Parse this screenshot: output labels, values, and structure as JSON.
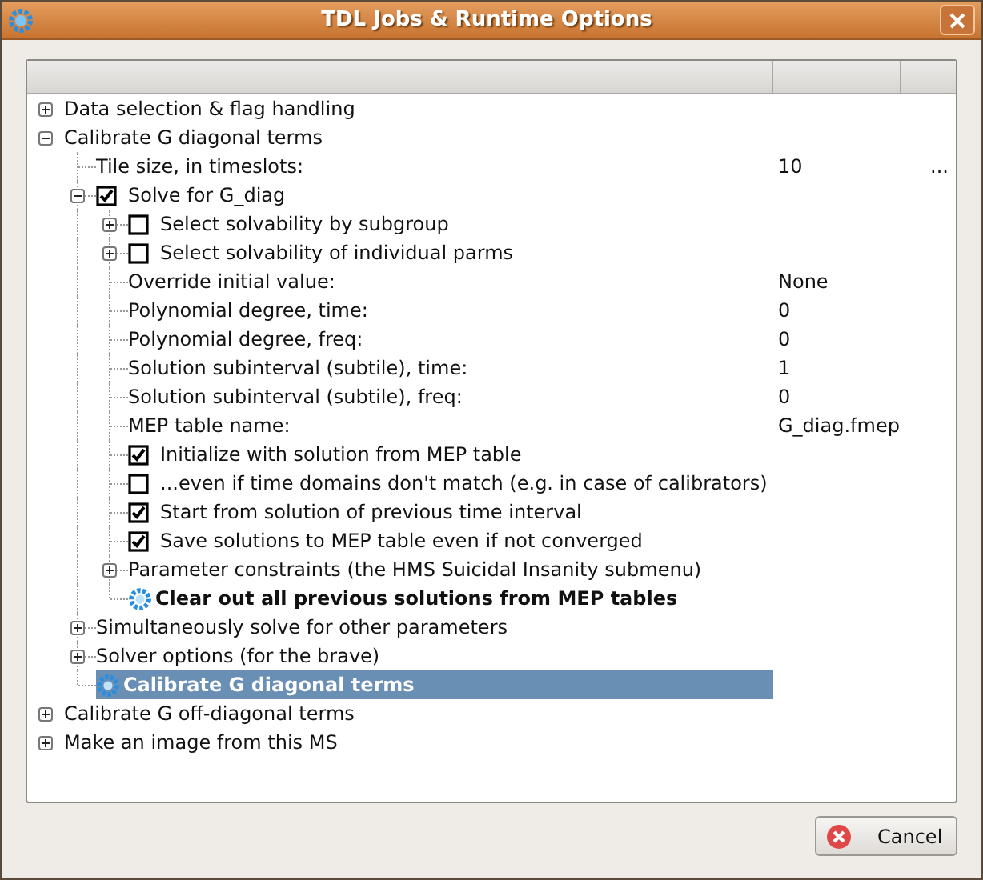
{
  "window": {
    "title": "TDL Jobs & Runtime Options"
  },
  "tree": [
    {
      "kind": "group",
      "label": "Data selection & flag handling",
      "expanded": false,
      "selected": false
    },
    {
      "kind": "group",
      "label": "Calibrate G diagonal terms",
      "expanded": true,
      "selected": false,
      "children": [
        {
          "kind": "option",
          "label": "Tile size, in timeslots:",
          "value": "10",
          "extra": "...",
          "selected": false
        },
        {
          "kind": "checkbox",
          "label": "Solve for G_diag",
          "checked": true,
          "expanded": true,
          "selected": false,
          "children": [
            {
              "kind": "checkbox",
              "label": "Select solvability by subgroup",
              "checked": false,
              "expanded": false,
              "selected": false
            },
            {
              "kind": "checkbox",
              "label": "Select solvability of individual parms",
              "checked": false,
              "expanded": false,
              "selected": false
            },
            {
              "kind": "option",
              "label": "Override initial value:",
              "value": "None",
              "selected": false
            },
            {
              "kind": "option",
              "label": "Polynomial degree, time:",
              "value": "0",
              "selected": false
            },
            {
              "kind": "option",
              "label": "Polynomial degree, freq:",
              "value": "0",
              "selected": false
            },
            {
              "kind": "option",
              "label": "Solution subinterval (subtile), time:",
              "value": "1",
              "selected": false
            },
            {
              "kind": "option",
              "label": "Solution subinterval (subtile), freq:",
              "value": "0",
              "selected": false
            },
            {
              "kind": "option",
              "label": "MEP table name:",
              "value": "G_diag.fmep",
              "selected": false
            },
            {
              "kind": "checkbox",
              "label": "Initialize with solution from MEP table",
              "checked": true,
              "selected": false
            },
            {
              "kind": "checkbox",
              "label": "...even if time domains don't match (e.g. in case of calibrators)",
              "checked": false,
              "selected": false
            },
            {
              "kind": "checkbox",
              "label": "Start from solution of previous time interval",
              "checked": true,
              "selected": false
            },
            {
              "kind": "checkbox",
              "label": "Save solutions to MEP table even if not converged",
              "checked": true,
              "selected": false
            },
            {
              "kind": "group",
              "label": "Parameter constraints (the HMS Suicidal Insanity submenu)",
              "expanded": false,
              "selected": false
            },
            {
              "kind": "action",
              "label": "Clear out all previous solutions from MEP tables",
              "selected": false
            }
          ]
        },
        {
          "kind": "group",
          "label": "Simultaneously solve for other parameters",
          "expanded": false,
          "selected": false
        },
        {
          "kind": "group",
          "label": "Solver options (for the brave)",
          "expanded": false,
          "selected": false
        },
        {
          "kind": "action",
          "label": "Calibrate G diagonal terms",
          "selected": true
        }
      ]
    },
    {
      "kind": "group",
      "label": "Calibrate G off-diagonal terms",
      "expanded": false,
      "selected": false
    },
    {
      "kind": "group",
      "label": "Make an image from this MS",
      "expanded": false,
      "selected": false
    }
  ],
  "buttons": [
    {
      "label": "Cancel"
    }
  ]
}
